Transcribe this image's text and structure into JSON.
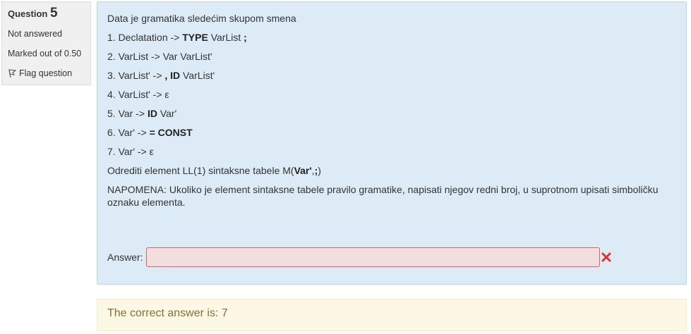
{
  "info": {
    "question_label": "Question",
    "question_number": "5",
    "state": "Not answered",
    "grade": "Marked out of 0.50",
    "flag_label": "Flag question"
  },
  "question": {
    "intro": "Data je gramatika sledećim skupom smena",
    "rules": [
      {
        "prefix": "1. Declatation -> ",
        "bold": "TYPE",
        "mid": " VarList ",
        "bold2": ";",
        "suffix": ""
      },
      {
        "prefix": "2. VarList -> Var VarList'",
        "bold": "",
        "mid": "",
        "bold2": "",
        "suffix": ""
      },
      {
        "prefix": "3.  VarList' -> ",
        "bold": ", ID",
        "mid": " VarList'",
        "bold2": "",
        "suffix": ""
      },
      {
        "prefix": "4. VarList' -> ε",
        "bold": "",
        "mid": "",
        "bold2": "",
        "suffix": ""
      },
      {
        "prefix": "5. Var -> ",
        "bold": "ID",
        "mid": " Var'",
        "bold2": "",
        "suffix": ""
      },
      {
        "prefix": "6. Var' -> ",
        "bold": "= CONST",
        "mid": "",
        "bold2": "",
        "suffix": ""
      },
      {
        "prefix": "7.  Var' -> ε",
        "bold": "",
        "mid": "",
        "bold2": "",
        "suffix": ""
      }
    ],
    "task_prefix": "Odrediti element LL(1) sintaksne tabele M(",
    "task_bold": "Var'",
    "task_mid": ",",
    "task_bold2": ";",
    "task_suffix": ")",
    "note": "NAPOMENA: Ukoliko je element sintaksne tabele pravilo gramatike, napisati njegov redni broj, u suprotnom upisati simboličku oznaku elementa."
  },
  "answer": {
    "label": "Answer:",
    "value": ""
  },
  "feedback": {
    "right_answer": "The correct answer is: 7"
  },
  "colors": {
    "formulation_bg": "#dcebf6",
    "feedback_bg": "#fcf8e3",
    "incorrect": "#e03030"
  }
}
